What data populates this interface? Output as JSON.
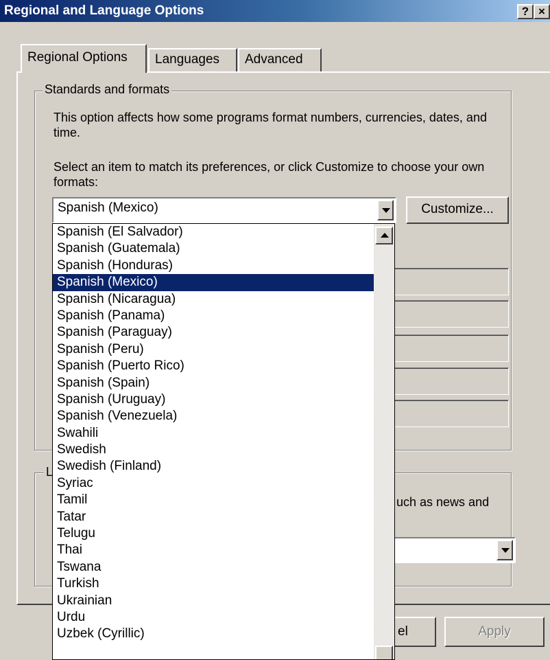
{
  "window": {
    "title": "Regional and Language Options",
    "help_glyph": "?",
    "close_glyph": "×"
  },
  "tabs": [
    {
      "label": "Regional Options",
      "active": true
    },
    {
      "label": "Languages",
      "active": false
    },
    {
      "label": "Advanced",
      "active": false
    }
  ],
  "standards": {
    "legend": "Standards and formats",
    "description": "This option affects how some programs format numbers, currencies, dates, and time.",
    "instruction": "Select an item to match its preferences, or click Customize to choose your own formats:",
    "selected": "Spanish (Mexico)",
    "customize_label": "Customize..."
  },
  "location": {
    "legend_letter": "L",
    "visible_text": "uch as news and"
  },
  "footer": {
    "cancel_partial": "el",
    "apply_label": "Apply"
  },
  "dropdown": {
    "selected_index": 3,
    "items": [
      "Spanish (El Salvador)",
      "Spanish (Guatemala)",
      "Spanish (Honduras)",
      "Spanish (Mexico)",
      "Spanish (Nicaragua)",
      "Spanish (Panama)",
      "Spanish (Paraguay)",
      "Spanish (Peru)",
      "Spanish (Puerto Rico)",
      "Spanish (Spain)",
      "Spanish (Uruguay)",
      "Spanish (Venezuela)",
      "Swahili",
      "Swedish",
      "Swedish (Finland)",
      "Syriac",
      "Tamil",
      "Tatar",
      "Telugu",
      "Thai",
      "Tswana",
      "Turkish",
      "Ukrainian",
      "Urdu",
      "Uzbek (Cyrillic)"
    ]
  },
  "colors": {
    "title_start": "#0a246a",
    "title_end": "#a6caf0",
    "selection": "#0a246a",
    "face": "#d4d0c8"
  }
}
